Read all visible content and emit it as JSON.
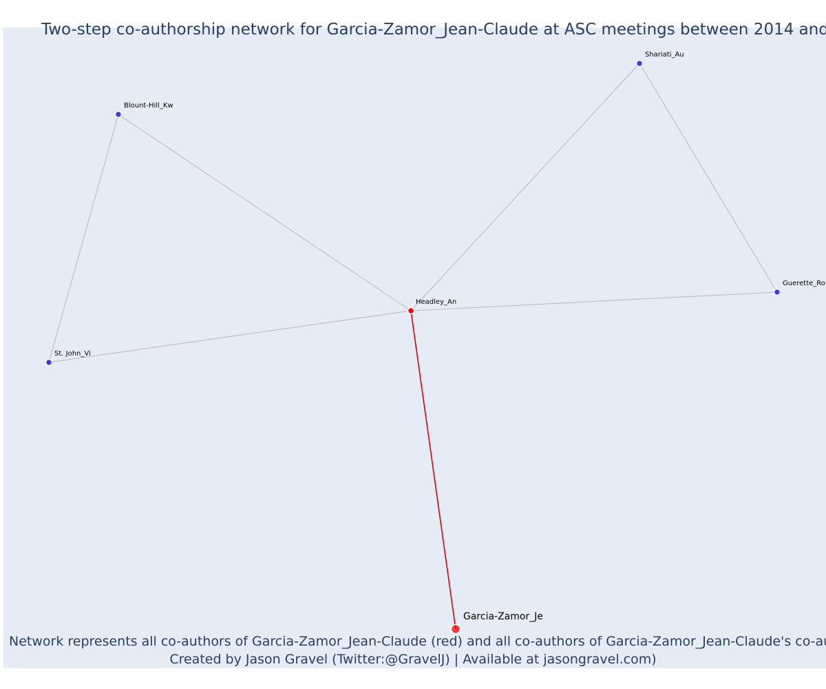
{
  "title": "Two-step co-authorship network for Garcia-Zamor_Jean-Claude at ASC meetings between 2014 and",
  "caption": {
    "line1": "Network represents all co-authors of Garcia-Zamor_Jean-Claude (red) and all co-authors of Garcia-Zamor_Jean-Claude's co-autho",
    "line2": "Created by Jason Gravel (Twitter:@GravelJ) | Available at jasongravel.com)"
  },
  "colors": {
    "background": "#e5ecf6",
    "focal": "#ff0000",
    "coauthor": "#ff0000",
    "second_step": "#3c3ce6",
    "edge": "#b4b4c8",
    "focal_edge": "#dd0000"
  },
  "network": {
    "nodes": [
      {
        "id": "Garcia-Zamor_Je",
        "label": "Garcia-Zamor_Je",
        "role": "focal"
      },
      {
        "id": "Headley_An",
        "label": "Headley_An",
        "role": "coauthor"
      },
      {
        "id": "Blount-Hill_Kw",
        "label": "Blount-Hill_Kw",
        "role": "second_step"
      },
      {
        "id": "St. John_Vi",
        "label": "St. John_Vi",
        "role": "second_step"
      },
      {
        "id": "Shariati_Au",
        "label": "Shariati_Au",
        "role": "second_step"
      },
      {
        "id": "Guerette_Ro",
        "label": "Guerette_Ro",
        "role": "second_step"
      }
    ],
    "edges": [
      {
        "source": "Garcia-Zamor_Je",
        "target": "Headley_An",
        "highlight": true
      },
      {
        "source": "Headley_An",
        "target": "Blount-Hill_Kw",
        "highlight": false
      },
      {
        "source": "Headley_An",
        "target": "St. John_Vi",
        "highlight": false
      },
      {
        "source": "Headley_An",
        "target": "Shariati_Au",
        "highlight": false
      },
      {
        "source": "Headley_An",
        "target": "Guerette_Ro",
        "highlight": false
      },
      {
        "source": "Blount-Hill_Kw",
        "target": "St. John_Vi",
        "highlight": false
      },
      {
        "source": "Shariati_Au",
        "target": "Guerette_Ro",
        "highlight": false
      }
    ]
  }
}
